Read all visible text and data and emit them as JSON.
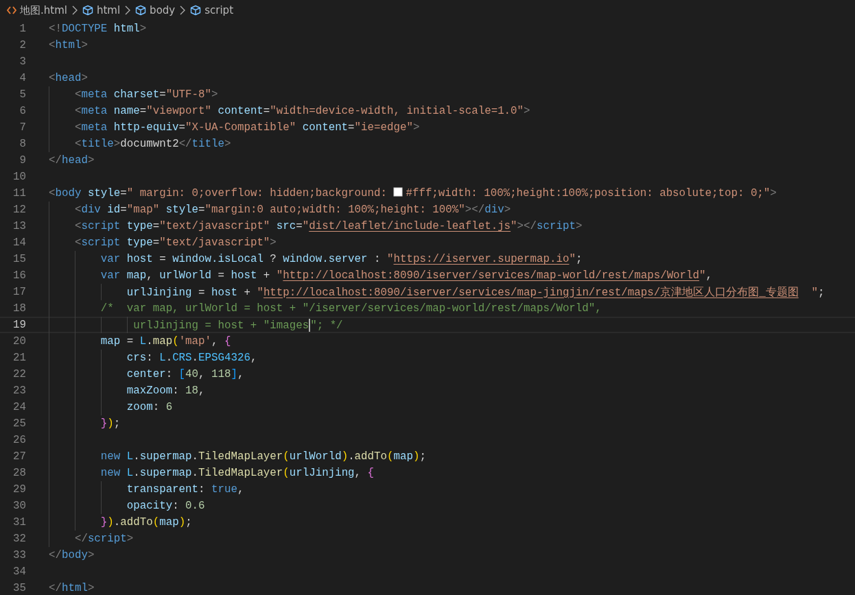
{
  "breadcrumb": [
    {
      "kind": "file",
      "label": "地图.html"
    },
    {
      "kind": "symbol",
      "label": "html"
    },
    {
      "kind": "symbol",
      "label": "body"
    },
    {
      "kind": "symbol",
      "label": "script"
    }
  ],
  "editor": {
    "lines": [
      {
        "number": "1",
        "current": false,
        "tokens": [
          {
            "kind": "punct",
            "text": "<!"
          },
          {
            "kind": "tag",
            "text": "DOCTYPE"
          },
          {
            "kind": "attr",
            "text": " html"
          },
          {
            "kind": "punct",
            "text": ">"
          }
        ]
      },
      {
        "number": "2",
        "current": false,
        "tokens": [
          {
            "kind": "punct",
            "text": "<"
          },
          {
            "kind": "tag",
            "text": "html"
          },
          {
            "kind": "punct",
            "text": ">"
          }
        ]
      },
      {
        "number": "3",
        "current": false
      },
      {
        "number": "4",
        "current": false,
        "tokens": [
          {
            "kind": "punct",
            "text": "<"
          },
          {
            "kind": "tag",
            "text": "head"
          },
          {
            "kind": "punct",
            "text": ">"
          }
        ]
      },
      {
        "number": "5",
        "current": false,
        "tokens": [
          {
            "kind": "punct",
            "text": "    <"
          },
          {
            "kind": "tag",
            "text": "meta"
          },
          {
            "kind": "attr",
            "text": " charset"
          },
          {
            "kind": "text",
            "text": "="
          },
          {
            "kind": "string",
            "text": "\"UTF-8\""
          },
          {
            "kind": "punct",
            "text": ">"
          }
        ]
      },
      {
        "number": "6",
        "current": false,
        "tokens": [
          {
            "kind": "punct",
            "text": "    <"
          },
          {
            "kind": "tag",
            "text": "meta"
          },
          {
            "kind": "attr",
            "text": " name"
          },
          {
            "kind": "text",
            "text": "="
          },
          {
            "kind": "string",
            "text": "\"viewport\""
          },
          {
            "kind": "attr",
            "text": " content"
          },
          {
            "kind": "text",
            "text": "="
          },
          {
            "kind": "string",
            "text": "\"width=device-width, initial-scale=1.0\""
          },
          {
            "kind": "punct",
            "text": ">"
          }
        ]
      },
      {
        "number": "7",
        "current": false,
        "tokens": [
          {
            "kind": "punct",
            "text": "    <"
          },
          {
            "kind": "tag",
            "text": "meta"
          },
          {
            "kind": "attr",
            "text": " http-equiv"
          },
          {
            "kind": "text",
            "text": "="
          },
          {
            "kind": "string",
            "text": "\"X-UA-Compatible\""
          },
          {
            "kind": "attr",
            "text": " content"
          },
          {
            "kind": "text",
            "text": "="
          },
          {
            "kind": "string",
            "text": "\"ie=edge\""
          },
          {
            "kind": "punct",
            "text": ">"
          }
        ]
      },
      {
        "number": "8",
        "current": false,
        "tokens": [
          {
            "kind": "punct",
            "text": "    <"
          },
          {
            "kind": "tag",
            "text": "title"
          },
          {
            "kind": "punct",
            "text": ">"
          },
          {
            "kind": "text",
            "text": "documwnt2"
          },
          {
            "kind": "punct",
            "text": "</"
          },
          {
            "kind": "tag",
            "text": "title"
          },
          {
            "kind": "punct",
            "text": ">"
          }
        ]
      },
      {
        "number": "9",
        "current": false,
        "tokens": [
          {
            "kind": "punct",
            "text": "</"
          },
          {
            "kind": "tag",
            "text": "head"
          },
          {
            "kind": "punct",
            "text": ">"
          }
        ]
      },
      {
        "number": "10",
        "current": false
      },
      {
        "number": "11",
        "current": false,
        "tokens": [
          {
            "kind": "punct",
            "text": "<"
          },
          {
            "kind": "tag",
            "text": "body"
          },
          {
            "kind": "attr",
            "text": " style"
          },
          {
            "kind": "text",
            "text": "="
          },
          {
            "kind": "string",
            "text": "\" margin: 0;overflow: hidden;background: "
          },
          {
            "kind": "swatch",
            "text": "#fff;width: 100%;height:100%;position: absolute;top: 0;\""
          },
          {
            "kind": "punct",
            "text": ">"
          }
        ]
      },
      {
        "number": "12",
        "current": false,
        "tokens": [
          {
            "kind": "punct",
            "text": "    <"
          },
          {
            "kind": "tag",
            "text": "div"
          },
          {
            "kind": "attr",
            "text": " id"
          },
          {
            "kind": "text",
            "text": "="
          },
          {
            "kind": "string",
            "text": "\"map\""
          },
          {
            "kind": "attr",
            "text": " style"
          },
          {
            "kind": "text",
            "text": "="
          },
          {
            "kind": "string",
            "text": "\"margin:0 auto;width: 100%;height: 100%\""
          },
          {
            "kind": "punct",
            "text": "></"
          },
          {
            "kind": "tag",
            "text": "div"
          },
          {
            "kind": "punct",
            "text": ">"
          }
        ]
      },
      {
        "number": "13",
        "current": false,
        "tokens": [
          {
            "kind": "punct",
            "text": "    <"
          },
          {
            "kind": "tag",
            "text": "script"
          },
          {
            "kind": "attr",
            "text": " type"
          },
          {
            "kind": "text",
            "text": "="
          },
          {
            "kind": "string",
            "text": "\"text/javascript\""
          },
          {
            "kind": "attr",
            "text": " src"
          },
          {
            "kind": "text",
            "text": "="
          },
          {
            "kind": "string",
            "text": "\""
          },
          {
            "kind": "link",
            "text": "dist/leaflet/include-leaflet.js"
          },
          {
            "kind": "string",
            "text": "\""
          },
          {
            "kind": "punct",
            "text": "></"
          },
          {
            "kind": "tag",
            "text": "script"
          },
          {
            "kind": "punct",
            "text": ">"
          }
        ]
      },
      {
        "number": "14",
        "current": false,
        "tokens": [
          {
            "kind": "punct",
            "text": "    <"
          },
          {
            "kind": "tag",
            "text": "script"
          },
          {
            "kind": "attr",
            "text": " type"
          },
          {
            "kind": "text",
            "text": "="
          },
          {
            "kind": "string",
            "text": "\"text/javascript\""
          },
          {
            "kind": "punct",
            "text": ">"
          }
        ]
      },
      {
        "number": "15",
        "current": false,
        "tokens": [
          {
            "kind": "keyword",
            "text": "        var"
          },
          {
            "kind": "variable",
            "text": " host"
          },
          {
            "kind": "text",
            "text": " = "
          },
          {
            "kind": "variable",
            "text": "window.isLocal"
          },
          {
            "kind": "text",
            "text": " ? "
          },
          {
            "kind": "variable",
            "text": "window.server"
          },
          {
            "kind": "text",
            "text": " : "
          },
          {
            "kind": "string",
            "text": "\""
          },
          {
            "kind": "link",
            "text": "https://iserver.supermap.io"
          },
          {
            "kind": "string",
            "text": "\""
          },
          {
            "kind": "text",
            "text": ";"
          }
        ]
      },
      {
        "number": "16",
        "current": false,
        "tokens": [
          {
            "kind": "keyword",
            "text": "        var"
          },
          {
            "kind": "variable",
            "text": " map"
          },
          {
            "kind": "text",
            "text": ", "
          },
          {
            "kind": "variable",
            "text": "urlWorld"
          },
          {
            "kind": "text",
            "text": " = "
          },
          {
            "kind": "variable",
            "text": "host"
          },
          {
            "kind": "text",
            "text": " + "
          },
          {
            "kind": "string",
            "text": "\""
          },
          {
            "kind": "link",
            "text": "http://localhost:8090/iserver/services/map-world/rest/maps/World"
          },
          {
            "kind": "string",
            "text": "\""
          },
          {
            "kind": "text",
            "text": ","
          }
        ]
      },
      {
        "number": "17",
        "current": false,
        "tokens": [
          {
            "kind": "variable",
            "text": "            urlJinjing"
          },
          {
            "kind": "text",
            "text": " = "
          },
          {
            "kind": "variable",
            "text": "host"
          },
          {
            "kind": "text",
            "text": " + "
          },
          {
            "kind": "string",
            "text": "\""
          },
          {
            "kind": "link",
            "text": "http://localhost:8090/iserver/services/map-jingjin/rest/maps/京津地区人口分布图_专题图"
          },
          {
            "kind": "string",
            "text": "  \""
          },
          {
            "kind": "text",
            "text": ";"
          }
        ]
      },
      {
        "number": "18",
        "current": false,
        "tokens": [
          {
            "kind": "comment",
            "text": "        /*  var map, urlWorld = host + \"/iserver/services/map-world/rest/maps/World\","
          }
        ]
      },
      {
        "number": "19",
        "current": true,
        "tokens": [
          {
            "kind": "comment",
            "text": "             urlJinjing = host + \"images",
            "caret": true
          },
          {
            "kind": "comment",
            "text": "\"; */"
          }
        ]
      },
      {
        "number": "20",
        "current": false,
        "tokens": [
          {
            "kind": "variable",
            "text": "        map"
          },
          {
            "kind": "text",
            "text": " = "
          },
          {
            "kind": "class",
            "text": "L"
          },
          {
            "kind": "text",
            "text": "."
          },
          {
            "kind": "function",
            "text": "map"
          },
          {
            "kind": "bracket1",
            "text": "("
          },
          {
            "kind": "string",
            "text": "'map'"
          },
          {
            "kind": "text",
            "text": ", "
          },
          {
            "kind": "bracket2",
            "text": "{"
          }
        ]
      },
      {
        "number": "21",
        "current": false,
        "tokens": [
          {
            "kind": "variable",
            "text": "            crs"
          },
          {
            "kind": "text",
            "text": ": "
          },
          {
            "kind": "class",
            "text": "L"
          },
          {
            "kind": "text",
            "text": "."
          },
          {
            "kind": "class",
            "text": "CRS"
          },
          {
            "kind": "text",
            "text": "."
          },
          {
            "kind": "class",
            "text": "EPSG4326"
          },
          {
            "kind": "text",
            "text": ","
          }
        ]
      },
      {
        "number": "22",
        "current": false,
        "tokens": [
          {
            "kind": "variable",
            "text": "            center"
          },
          {
            "kind": "text",
            "text": ": "
          },
          {
            "kind": "bracket3",
            "text": "["
          },
          {
            "kind": "number",
            "text": "40"
          },
          {
            "kind": "text",
            "text": ", "
          },
          {
            "kind": "number",
            "text": "118"
          },
          {
            "kind": "bracket3",
            "text": "]"
          },
          {
            "kind": "text",
            "text": ","
          }
        ]
      },
      {
        "number": "23",
        "current": false,
        "tokens": [
          {
            "kind": "variable",
            "text": "            maxZoom"
          },
          {
            "kind": "text",
            "text": ": "
          },
          {
            "kind": "number",
            "text": "18"
          },
          {
            "kind": "text",
            "text": ","
          }
        ]
      },
      {
        "number": "24",
        "current": false,
        "tokens": [
          {
            "kind": "variable",
            "text": "            zoom"
          },
          {
            "kind": "text",
            "text": ": "
          },
          {
            "kind": "number",
            "text": "6"
          }
        ]
      },
      {
        "number": "25",
        "current": false,
        "tokens": [
          {
            "kind": "bracket2",
            "text": "        }"
          },
          {
            "kind": "bracket1",
            "text": ")"
          },
          {
            "kind": "text",
            "text": ";"
          }
        ]
      },
      {
        "number": "26",
        "current": false
      },
      {
        "number": "27",
        "current": false,
        "tokens": [
          {
            "kind": "keyword",
            "text": "        new"
          },
          {
            "kind": "class",
            "text": " L"
          },
          {
            "kind": "text",
            "text": "."
          },
          {
            "kind": "variable",
            "text": "supermap"
          },
          {
            "kind": "text",
            "text": "."
          },
          {
            "kind": "function",
            "text": "TiledMapLayer"
          },
          {
            "kind": "bracket1",
            "text": "("
          },
          {
            "kind": "variable",
            "text": "urlWorld"
          },
          {
            "kind": "bracket1",
            "text": ")"
          },
          {
            "kind": "text",
            "text": "."
          },
          {
            "kind": "function",
            "text": "addTo"
          },
          {
            "kind": "bracket1",
            "text": "("
          },
          {
            "kind": "variable",
            "text": "map"
          },
          {
            "kind": "bracket1",
            "text": ")"
          },
          {
            "kind": "text",
            "text": ";"
          }
        ]
      },
      {
        "number": "28",
        "current": false,
        "tokens": [
          {
            "kind": "keyword",
            "text": "        new"
          },
          {
            "kind": "class",
            "text": " L"
          },
          {
            "kind": "text",
            "text": "."
          },
          {
            "kind": "variable",
            "text": "supermap"
          },
          {
            "kind": "text",
            "text": "."
          },
          {
            "kind": "function",
            "text": "TiledMapLayer"
          },
          {
            "kind": "bracket1",
            "text": "("
          },
          {
            "kind": "variable",
            "text": "urlJinjing"
          },
          {
            "kind": "text",
            "text": ", "
          },
          {
            "kind": "bracket2",
            "text": "{"
          }
        ]
      },
      {
        "number": "29",
        "current": false,
        "tokens": [
          {
            "kind": "variable",
            "text": "            transparent"
          },
          {
            "kind": "text",
            "text": ": "
          },
          {
            "kind": "keyword",
            "text": "true"
          },
          {
            "kind": "text",
            "text": ","
          }
        ]
      },
      {
        "number": "30",
        "current": false,
        "tokens": [
          {
            "kind": "variable",
            "text": "            opacity"
          },
          {
            "kind": "text",
            "text": ": "
          },
          {
            "kind": "number",
            "text": "0.6"
          }
        ]
      },
      {
        "number": "31",
        "current": false,
        "tokens": [
          {
            "kind": "bracket2",
            "text": "        }"
          },
          {
            "kind": "bracket1",
            "text": ")"
          },
          {
            "kind": "text",
            "text": "."
          },
          {
            "kind": "function",
            "text": "addTo"
          },
          {
            "kind": "bracket1",
            "text": "("
          },
          {
            "kind": "variable",
            "text": "map"
          },
          {
            "kind": "bracket1",
            "text": ")"
          },
          {
            "kind": "text",
            "text": ";"
          }
        ]
      },
      {
        "number": "32",
        "current": false,
        "tokens": [
          {
            "kind": "punct",
            "text": "    </"
          },
          {
            "kind": "tag",
            "text": "script"
          },
          {
            "kind": "punct",
            "text": ">"
          }
        ]
      },
      {
        "number": "33",
        "current": false,
        "tokens": [
          {
            "kind": "punct",
            "text": "</"
          },
          {
            "kind": "tag",
            "text": "body"
          },
          {
            "kind": "punct",
            "text": ">"
          }
        ]
      },
      {
        "number": "34",
        "current": false
      },
      {
        "number": "35",
        "current": false,
        "tokens": [
          {
            "kind": "punct",
            "text": "</"
          },
          {
            "kind": "tag",
            "text": "html"
          },
          {
            "kind": "punct",
            "text": ">"
          }
        ]
      }
    ]
  }
}
